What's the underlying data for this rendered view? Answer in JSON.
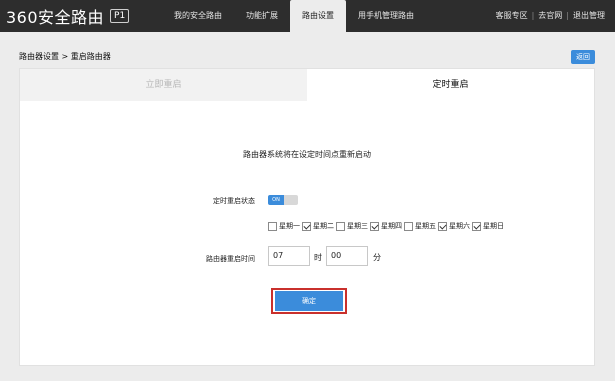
{
  "header": {
    "logo_text": "360安全路由",
    "model_badge": "P1",
    "nav": [
      {
        "label": "我的安全路由"
      },
      {
        "label": "功能扩展"
      },
      {
        "label": "路由设置"
      },
      {
        "label": "用手机管理路由"
      }
    ],
    "links": {
      "service": "客服专区",
      "sep1": "|",
      "official": "去官网",
      "sep2": "|",
      "logout": "退出管理"
    }
  },
  "breadcrumb": "路由器设置 > 重启路由器",
  "back_label": "返回",
  "tabs": [
    {
      "label": "立即重启"
    },
    {
      "label": "定时重启"
    }
  ],
  "message": "路由器系统将在设定时间点重新启动",
  "status": {
    "label": "定时重启状态",
    "toggle_text": "ON"
  },
  "days": [
    {
      "label": "星期一",
      "checked": false
    },
    {
      "label": "星期二",
      "checked": true
    },
    {
      "label": "星期三",
      "checked": false
    },
    {
      "label": "星期四",
      "checked": true
    },
    {
      "label": "星期五",
      "checked": false
    },
    {
      "label": "星期六",
      "checked": true
    },
    {
      "label": "星期日",
      "checked": true
    }
  ],
  "time": {
    "label": "路由器重启时间",
    "hour": "07",
    "hour_unit": "时",
    "minute": "00",
    "minute_unit": "分"
  },
  "confirm_label": "确定",
  "colors": {
    "topbar": "#2d2d2d",
    "accent": "#3b8cdb",
    "highlight": "#c9302c"
  }
}
